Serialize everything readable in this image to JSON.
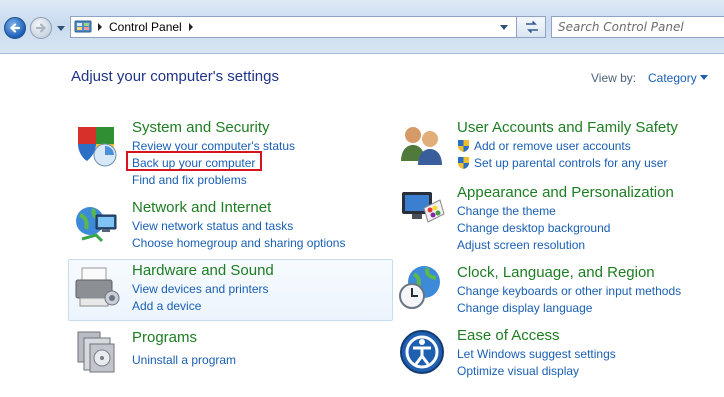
{
  "window": {
    "title": "Control Panel"
  },
  "address_bar": {
    "breadcrumb": "Control Panel"
  },
  "search": {
    "placeholder": "Search Control Panel"
  },
  "header": {
    "title": "Adjust your computer's settings",
    "view_by_label": "View by:",
    "view_by_value": "Category"
  },
  "categories": [
    {
      "title": "System and Security",
      "links": [
        "Review your computer's status",
        "Back up your computer",
        "Find and fix problems"
      ]
    },
    {
      "title": "Network and Internet",
      "links": [
        "View network status and tasks",
        "Choose homegroup and sharing options"
      ]
    },
    {
      "title": "Hardware and Sound",
      "links": [
        "View devices and printers",
        "Add a device"
      ]
    },
    {
      "title": "Programs",
      "links": [
        "Uninstall a program"
      ]
    },
    {
      "title": "User Accounts and Family Safety",
      "links": [
        "Add or remove user accounts",
        "Set up parental controls for any user"
      ]
    },
    {
      "title": "Appearance and Personalization",
      "links": [
        "Change the theme",
        "Change desktop background",
        "Adjust screen resolution"
      ]
    },
    {
      "title": "Clock, Language, and Region",
      "links": [
        "Change keyboards or other input methods",
        "Change display language"
      ]
    },
    {
      "title": "Ease of Access",
      "links": [
        "Let Windows suggest settings",
        "Optimize visual display"
      ]
    }
  ],
  "highlight": {
    "color": "#d7141e",
    "target": "Back up your computer"
  },
  "colors": {
    "category_title": "#1e7d22",
    "link": "#1a5fb4",
    "heading": "#1e3287"
  },
  "icons": [
    "back-arrow-icon",
    "forward-arrow-icon",
    "control-panel-icon",
    "refresh-icon",
    "shield-icon",
    "network-globe-icon",
    "printer-icon",
    "programs-icon",
    "users-icon",
    "monitor-palette-icon",
    "clock-globe-icon",
    "ease-of-access-icon"
  ]
}
